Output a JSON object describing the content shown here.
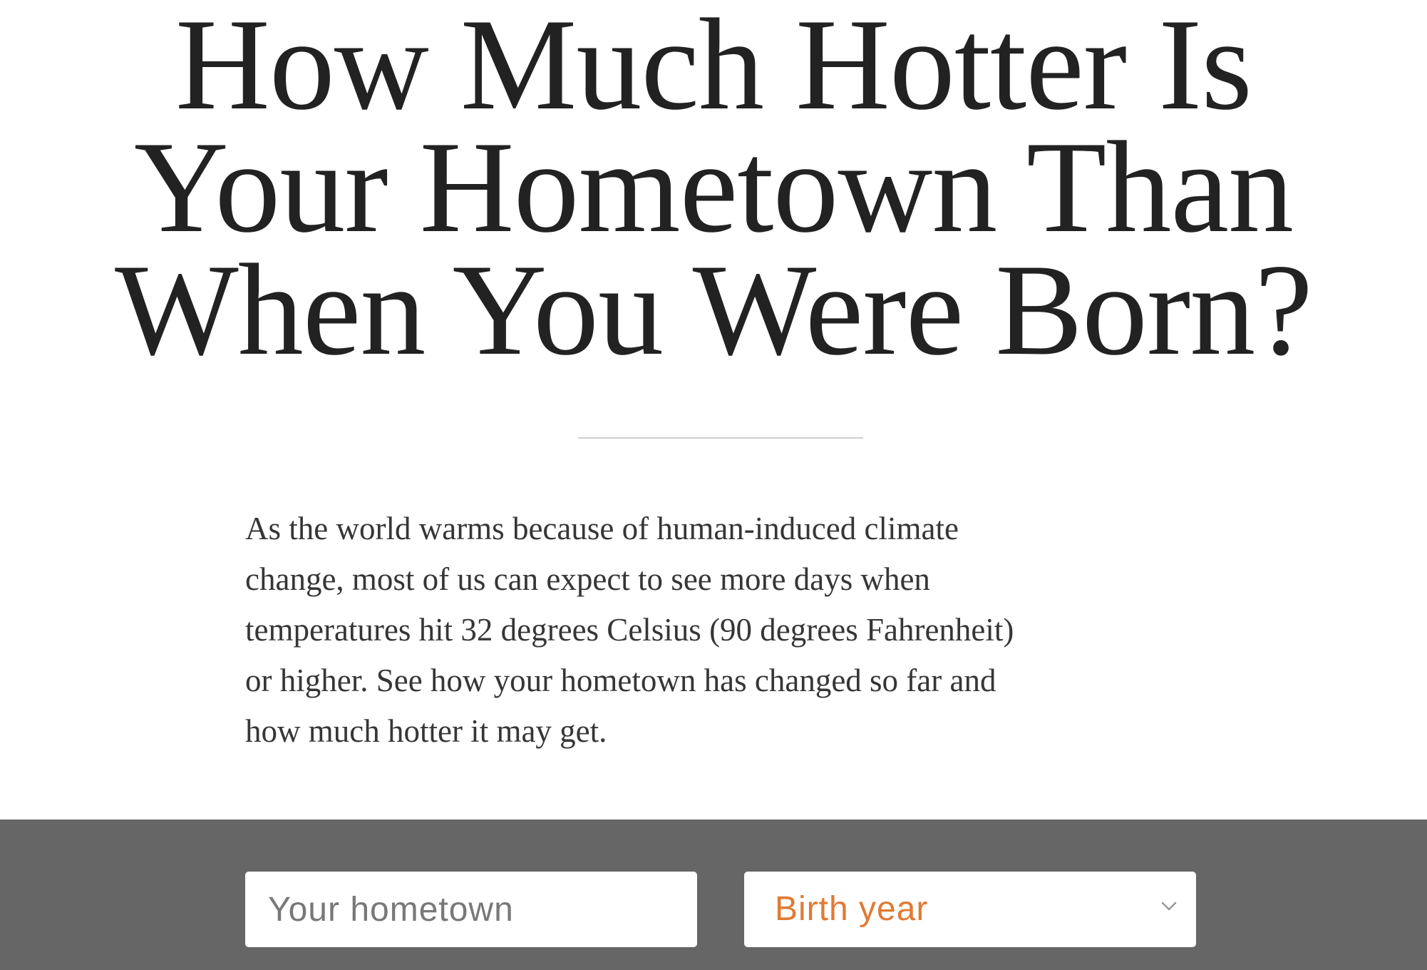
{
  "headline": {
    "lines": [
      "How Much Hotter Is",
      "Your Hometown Than",
      "When You Were Born?"
    ]
  },
  "intro": {
    "lines": [
      "As the world warms because of human-induced climate",
      "change, most of us can expect to see more days when",
      "temperatures hit 32 degrees Celsius (90 degrees Fahrenheit)",
      "or higher. See how your hometown has changed so far and",
      "how much hotter it may get."
    ]
  },
  "form": {
    "hometown_placeholder": "Your hometown",
    "birth_year_label": "Birth year",
    "dropdown_icon": "chevron-down-icon"
  },
  "colors": {
    "headline": "#222222",
    "body_text": "#363636",
    "controls_bar": "#666666",
    "birth_year_accent": "#e07a34",
    "divider": "#cfcfcf"
  }
}
